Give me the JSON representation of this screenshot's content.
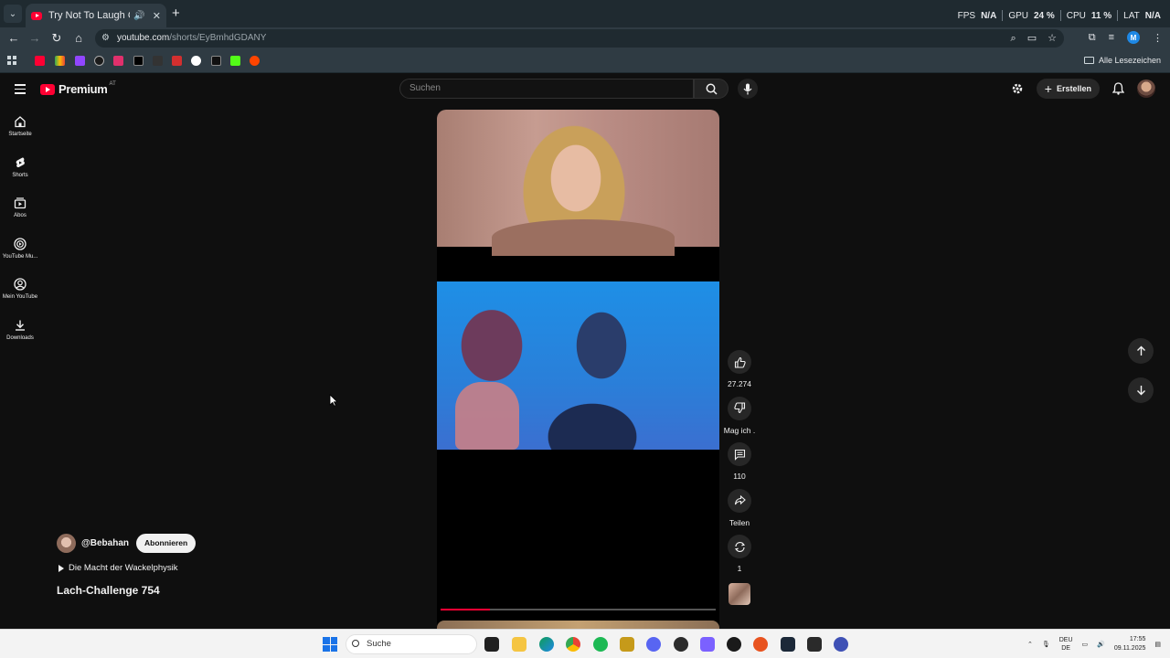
{
  "browser": {
    "tab_title": "Try Not To Laugh Challenge",
    "url_host": "youtube.com",
    "url_path": "/shorts/EyBmhdGDANY",
    "bookmarks_all": "Alle Lesezeichen",
    "perf": {
      "fps_label": "FPS",
      "fps_value": "N/A",
      "gpu_label": "GPU",
      "gpu_value": "24 %",
      "cpu_label": "CPU",
      "cpu_value": "11 %",
      "lat_label": "LAT",
      "lat_value": "N/A"
    }
  },
  "youtube": {
    "logo_text": "Premium",
    "country": "AT",
    "search_placeholder": "Suchen",
    "create_label": "Erstellen",
    "guide": [
      {
        "label": "Startseite",
        "icon": "home-icon"
      },
      {
        "label": "Shorts",
        "icon": "shorts-icon"
      },
      {
        "label": "Abos",
        "icon": "subscriptions-icon"
      },
      {
        "label": "YouTube Mu...",
        "icon": "youtube-music-icon"
      },
      {
        "label": "Mein YouTube",
        "icon": "you-icon"
      },
      {
        "label": "Downloads",
        "icon": "download-icon"
      }
    ],
    "actions": {
      "likes": "27.274",
      "dislike": "Mag ich .",
      "comments": "110",
      "share": "Teilen",
      "remix": "1"
    },
    "short": {
      "channel": "@Bebahan",
      "subscribe": "Abonnieren",
      "sound": "Die Macht der Wackelphysik",
      "title": "Lach-Challenge 754",
      "progress": 0.18
    }
  },
  "taskbar": {
    "search": "Suche",
    "lang_top": "DEU",
    "lang_bottom": "DE",
    "time": "17:55",
    "date": "09.11.2025"
  }
}
